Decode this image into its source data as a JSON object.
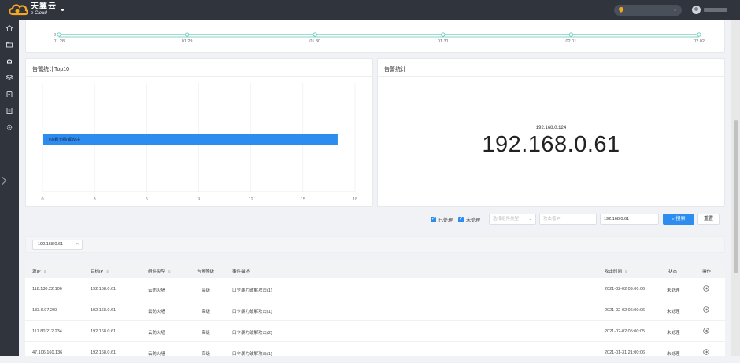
{
  "header": {
    "logo_cn": "天翼云",
    "logo_en": "e Cloud"
  },
  "trend": {
    "dates": [
      "01.28",
      "01.29",
      "01.30",
      "01.31",
      "02.01",
      "02.02"
    ],
    "y_label": "0",
    "line_color": "#5dc9b8"
  },
  "bar_card": {
    "title": "告警统计Top10"
  },
  "stat_card": {
    "title": "告警统计",
    "small_ip": "192.168.0.124",
    "big_ip": "192.168.0.61"
  },
  "chart_data": {
    "type": "bar",
    "orientation": "horizontal",
    "categories": [
      "口令暴力破解攻击"
    ],
    "values": [
      17
    ],
    "xlim": [
      0,
      18
    ],
    "xticks": [
      0,
      3,
      6,
      9,
      12,
      15,
      18
    ],
    "grid": true,
    "bar_color": "#2d8cf0"
  },
  "filters": {
    "processed_label": "已处理",
    "unprocessed_label": "未处理",
    "component_placeholder": "选择组件类型",
    "attacker_ip_placeholder": "攻击者IP",
    "target_ip_value": "192.168.0.61",
    "search_label": "搜索",
    "reset_label": "重置"
  },
  "tag": {
    "label": "192.168.0.61",
    "close": "×"
  },
  "table": {
    "columns": [
      "源IP",
      "目标IP",
      "组件类型",
      "告警等级",
      "事件描述",
      "攻击时间",
      "状态",
      "操作"
    ],
    "rows": [
      {
        "src": "118.130.22.106",
        "dst": "192.168.0.61",
        "component": "云防火墙",
        "level": "高级",
        "desc": "口令暴力破解攻击(1)",
        "time": "2021-02-02 09:00:06",
        "status": "未处理"
      },
      {
        "src": "183.6.97.203",
        "dst": "192.168.0.61",
        "component": "云防火墙",
        "level": "高级",
        "desc": "口令暴力破解攻击(1)",
        "time": "2021-02-02 06:00:06",
        "status": "未处理"
      },
      {
        "src": "117.80.212.234",
        "dst": "192.168.0.61",
        "component": "云防火墙",
        "level": "高级",
        "desc": "口令暴力破解攻击(2)",
        "time": "2021-02-02 05:00:05",
        "status": "未处理"
      },
      {
        "src": "47.106.160.136",
        "dst": "192.168.0.61",
        "component": "云防火墙",
        "level": "高级",
        "desc": "口令暴力破解攻击(1)",
        "time": "2021-01-31 21:00:06",
        "status": "未处理"
      }
    ]
  }
}
